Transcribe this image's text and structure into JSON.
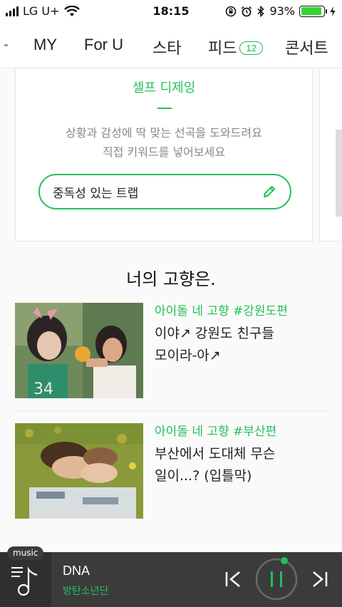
{
  "status": {
    "carrier": "LG U+",
    "time": "18:15",
    "battery": "93%",
    "battery_level": 0.93
  },
  "nav": {
    "tabs": [
      {
        "label": "MY"
      },
      {
        "label": "For U"
      },
      {
        "label": "스타"
      },
      {
        "label": "피드",
        "badge": "12"
      },
      {
        "label": "콘서트"
      }
    ]
  },
  "dj_card": {
    "title": "셀프 디제잉",
    "desc_line1": "상황과 감성에 딱 맞는 선곡을 도와드려요",
    "desc_line2": "직접 키워드를 넣어보세요",
    "keyword": "중독성 있는 트랩"
  },
  "section": {
    "title": "너의 고향은.",
    "items": [
      {
        "tag": "아이돌 네 고향 #강원도편",
        "title_line1": "이야↗ 강원도 친구들",
        "title_line2": "모이라-아↗"
      },
      {
        "tag": "아이돌 네 고향 #부산편",
        "title_line1": "부산에서 도대체 무슨",
        "title_line2": "일이...? (입틀막)"
      }
    ]
  },
  "player": {
    "badge": "music",
    "song": "DNA",
    "artist": "방탄소년단",
    "accent": "#23c05b"
  }
}
